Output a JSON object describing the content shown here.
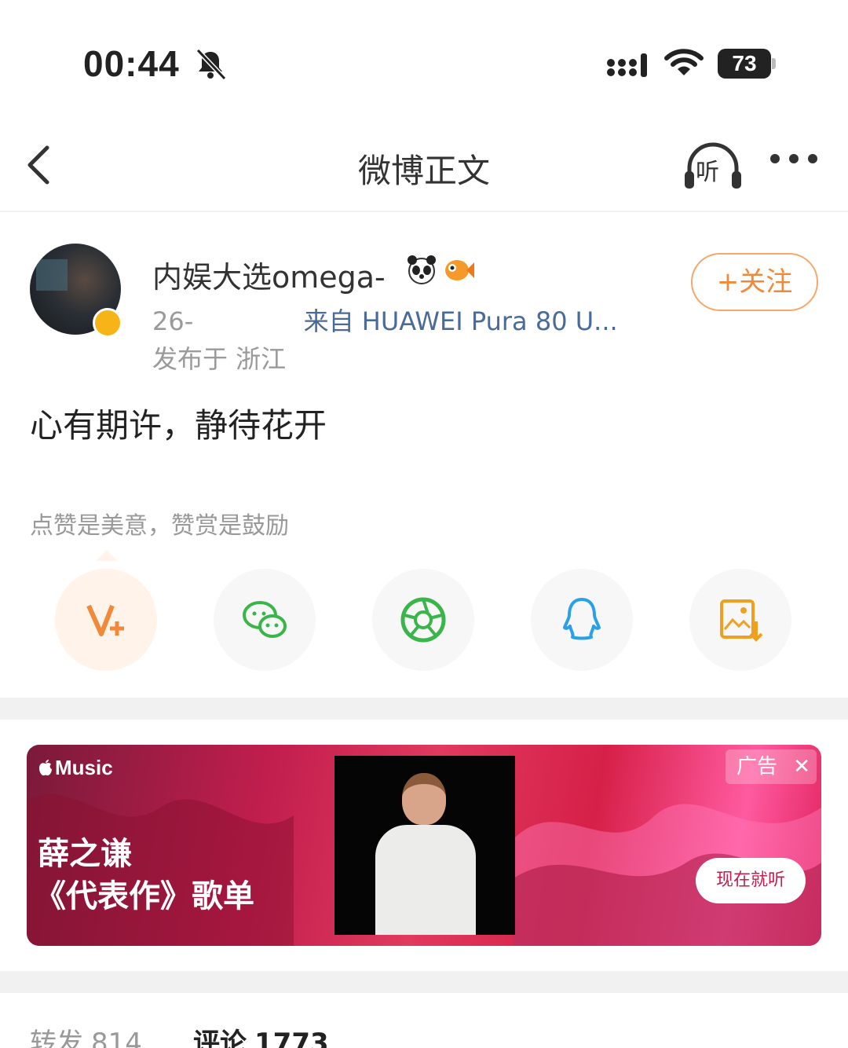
{
  "status_bar": {
    "time": "00:44",
    "battery": "73"
  },
  "nav": {
    "title": "微博正文",
    "listen_label": "听"
  },
  "post": {
    "user_name": "内娱大选omega-",
    "meta_prefix": "26-",
    "meta_source": "来自 HUAWEI Pura 80 U...",
    "location": "发布于 浙江",
    "follow_label": "+关注",
    "text": "心有期许，静待花开",
    "reward_hint": "点赞是美意，赞赏是鼓励"
  },
  "share_icons": [
    "v-plus-icon",
    "wechat-icon",
    "moments-icon",
    "qq-icon",
    "save-image-icon"
  ],
  "ad": {
    "brand": "Music",
    "artist": "薛之谦",
    "playlist": "《代表作》歌单",
    "tag": "广告",
    "cta": "现在就听",
    "colors": {
      "primary": "#c21e4e",
      "accent": "#ff5aa0"
    }
  },
  "tabs": {
    "repost_label": "转发",
    "repost_count": "814",
    "comment_label": "评论",
    "comment_count": "1773"
  },
  "colors": {
    "follow": "#f08a3a",
    "verified": "#f6b418",
    "device_link": "#4a6a9a"
  }
}
